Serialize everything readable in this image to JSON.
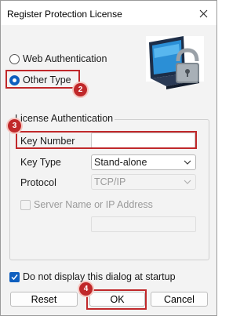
{
  "window": {
    "title": "Register Protection License"
  },
  "auth_mode": {
    "options": [
      {
        "label": "Web Authentication",
        "selected": false
      },
      {
        "label": "Other Type",
        "selected": true
      }
    ]
  },
  "license_group": {
    "legend": "License Authentication",
    "key_number": {
      "label": "Key Number",
      "value": ""
    },
    "key_type": {
      "label": "Key Type",
      "value": "Stand-alone"
    },
    "protocol": {
      "label": "Protocol",
      "value": "TCP/IP",
      "disabled": true
    },
    "server": {
      "label": "Server Name or IP Address",
      "checked": false,
      "disabled": true,
      "value": ""
    }
  },
  "startup_checkbox": {
    "label": "Do not display this dialog at startup",
    "checked": true
  },
  "buttons": {
    "reset": "Reset",
    "ok": "OK",
    "cancel": "Cancel"
  },
  "callouts": {
    "two": "2",
    "three": "3",
    "four": "4"
  },
  "colors": {
    "accent": "#0f5fbf",
    "callout": "#c0282a"
  },
  "icons": [
    "close-icon",
    "monitor-lock-icon",
    "chevron-down-icon",
    "checkmark-icon"
  ]
}
